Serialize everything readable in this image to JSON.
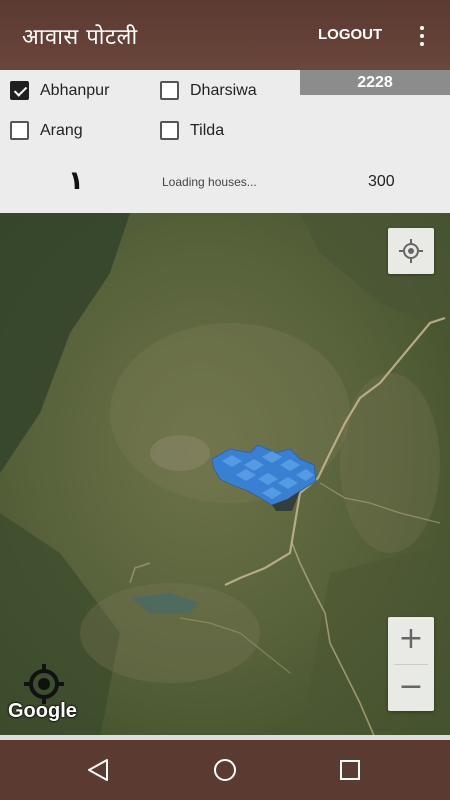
{
  "app": {
    "title": "आवास पोटली",
    "logout_label": "LOGOUT"
  },
  "filters": [
    {
      "label": "Abhanpur",
      "checked": true
    },
    {
      "label": "Dharsiwa",
      "checked": false
    },
    {
      "label": "Arang",
      "checked": false
    },
    {
      "label": "Tilda",
      "checked": false
    }
  ],
  "stats": {
    "total_count": "2228",
    "loaded_count": "١",
    "status_text": "Loading houses...",
    "limit_value": "300"
  },
  "map": {
    "attribution": "Google",
    "zoom_in_label": "+",
    "zoom_out_label": "−",
    "marker_color": "#3a80d2"
  },
  "icons": {
    "menu": "overflow-menu-icon",
    "locate": "my-location-icon",
    "target": "crosshair-target-icon",
    "back": "back-triangle-icon",
    "home": "home-circle-icon",
    "recents": "recents-square-icon"
  },
  "colors": {
    "appbar": "#5b3a31",
    "navbar": "#5b3a31",
    "count_bar": "#8c8c8c"
  }
}
